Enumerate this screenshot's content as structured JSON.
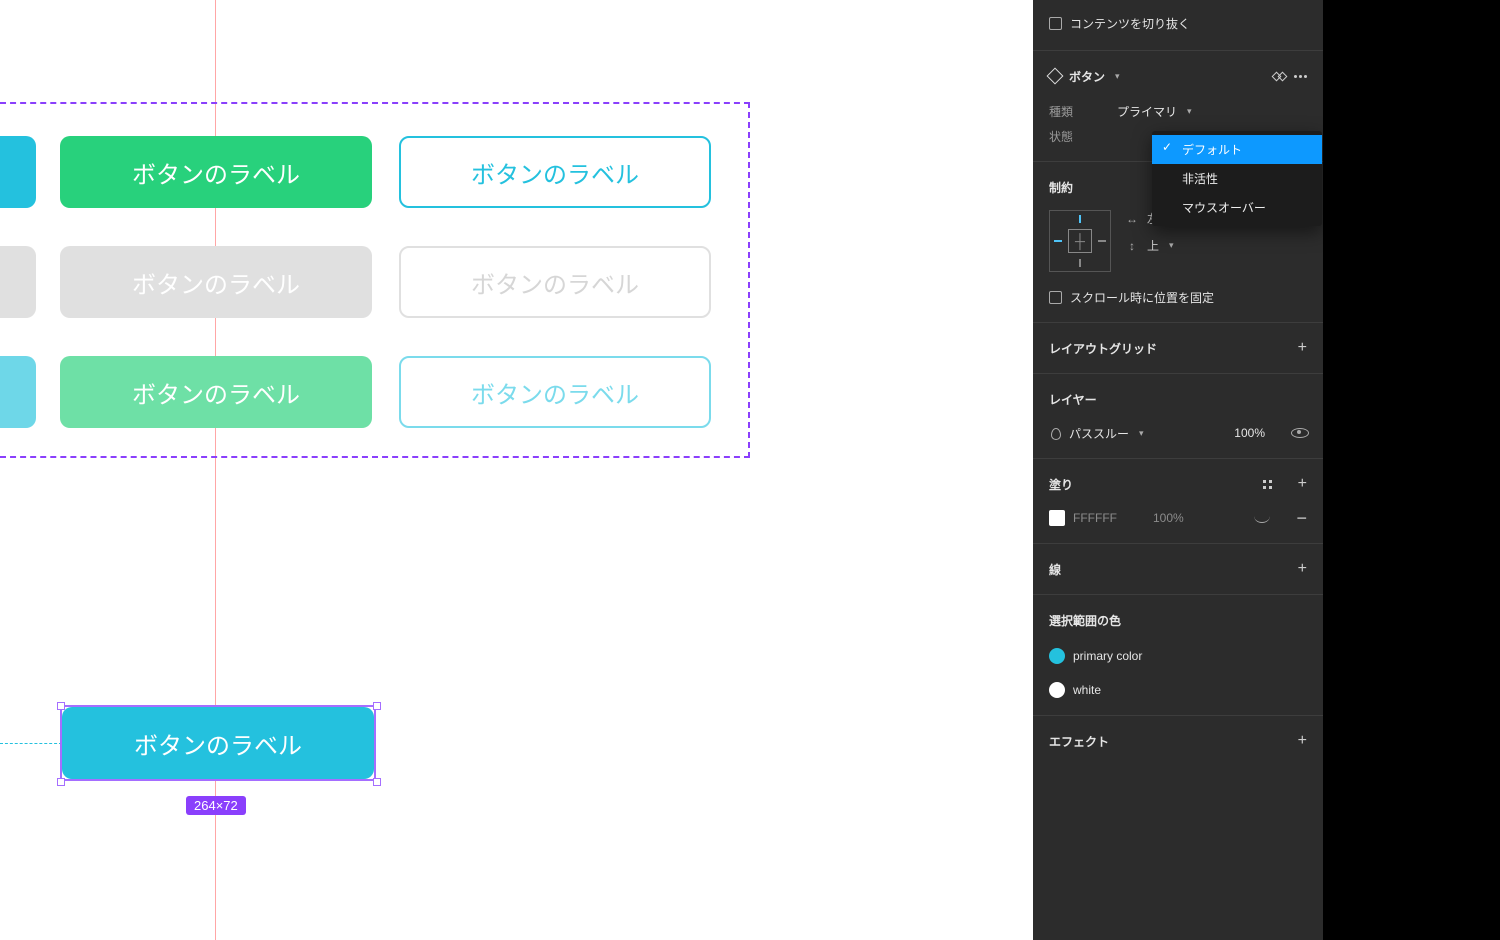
{
  "canvas": {
    "button_label": "ボタンのラベル",
    "selected_dim": "264×72"
  },
  "panel": {
    "clip_content": "コンテンツを切り抜く",
    "component_name": "ボタン",
    "props": {
      "type_label": "種類",
      "type_value": "プライマリ",
      "state_label": "状態"
    },
    "state_menu": {
      "default": "デフォルト",
      "disabled": "非活性",
      "hover": "マウスオーバー"
    },
    "constraints": {
      "title": "制約",
      "h_value": "左",
      "v_value": "上",
      "fix_scroll": "スクロール時に位置を固定"
    },
    "layout_grid": "レイアウトグリッド",
    "layer": {
      "title": "レイヤー",
      "blend": "パススルー",
      "opacity": "100%"
    },
    "fill": {
      "title": "塗り",
      "hex": "FFFFFF",
      "opacity": "100%"
    },
    "stroke": {
      "title": "線"
    },
    "selection_colors": {
      "title": "選択範囲の色",
      "c1_name": "primary color",
      "c2_name": "white"
    },
    "effects": {
      "title": "エフェクト"
    }
  }
}
